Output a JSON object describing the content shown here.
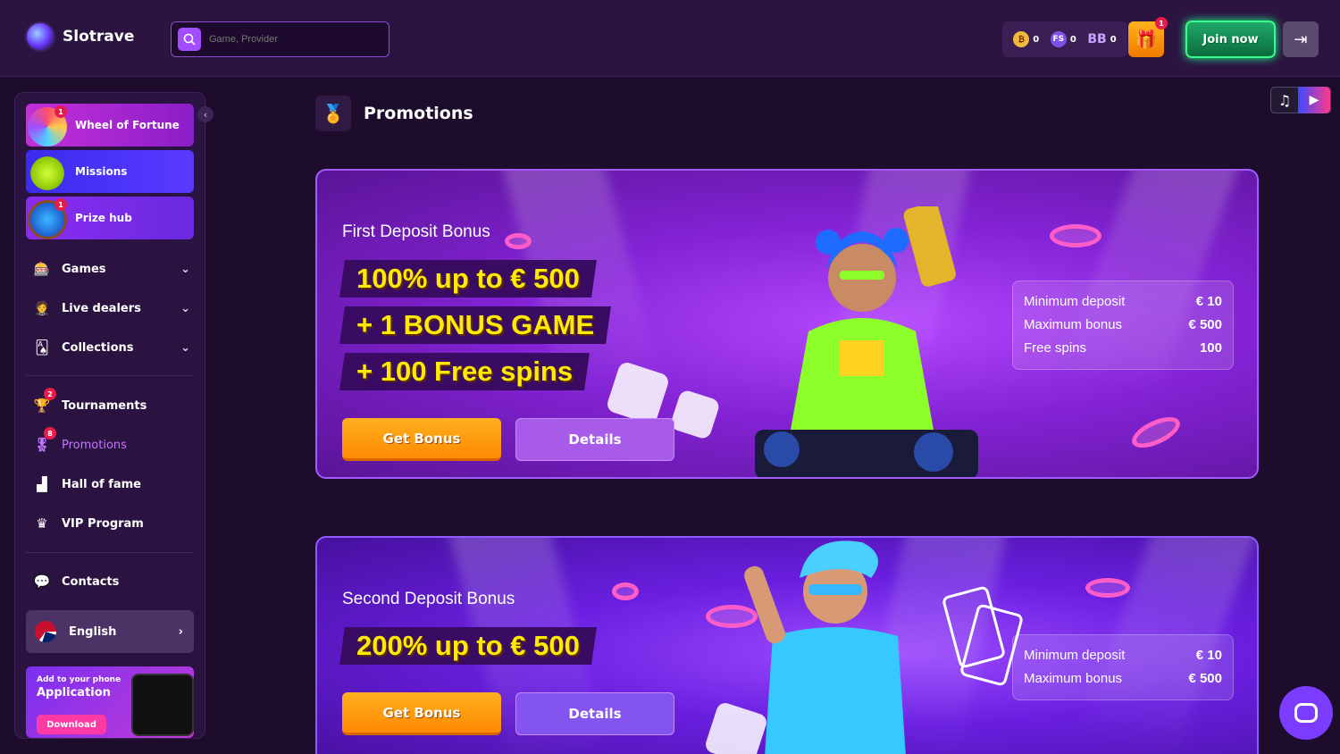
{
  "header": {
    "brand": "Slotrave",
    "search_placeholder": "Game, Provider",
    "balances": [
      {
        "icon": "bonus-coin-icon",
        "value": "0"
      },
      {
        "icon": "free-spins-icon",
        "value": "0"
      },
      {
        "icon": "bonus-balance-icon",
        "label": "BB",
        "value": "0"
      }
    ],
    "gift_badge": "1",
    "join_label": "Join now"
  },
  "sidebar": {
    "featured": [
      {
        "label": "Wheel of Fortune",
        "badge": "1"
      },
      {
        "label": "Missions"
      },
      {
        "label": "Prize hub",
        "badge": "1"
      }
    ],
    "menu": [
      {
        "label": "Games"
      },
      {
        "label": "Live dealers"
      },
      {
        "label": "Collections"
      }
    ],
    "links": [
      {
        "label": "Tournaments",
        "badge": "2"
      },
      {
        "label": "Promotions",
        "badge": "8"
      },
      {
        "label": "Hall of fame"
      },
      {
        "label": "VIP Program"
      }
    ],
    "contacts": "Contacts",
    "language": "English",
    "app": {
      "small": "Add to your phone",
      "big": "Application",
      "button": "Download"
    }
  },
  "page": {
    "title": "Promotions"
  },
  "promos": [
    {
      "title": "First Deposit Bonus",
      "lines": [
        "100% up to € 500",
        "+ 1 BONUS GAME",
        "+ 100 Free spins"
      ],
      "get": "Get Bonus",
      "details": "Details",
      "stats": [
        {
          "label": "Minimum deposit",
          "value": "€ 10"
        },
        {
          "label": "Maximum bonus",
          "value": "€ 500"
        },
        {
          "label": "Free spins",
          "value": "100"
        }
      ]
    },
    {
      "title": "Second Deposit Bonus",
      "lines": [
        "200% up to € 500"
      ],
      "get": "Get Bonus",
      "details": "Details",
      "stats": [
        {
          "label": "Minimum deposit",
          "value": "€ 10"
        },
        {
          "label": "Maximum bonus",
          "value": "€ 500"
        }
      ]
    }
  ],
  "colors": {
    "accent": "#a24dff",
    "join": "#22ff88",
    "gold": "#ffea00",
    "orange": "#ff8a00",
    "badge": "#e81c4a"
  }
}
